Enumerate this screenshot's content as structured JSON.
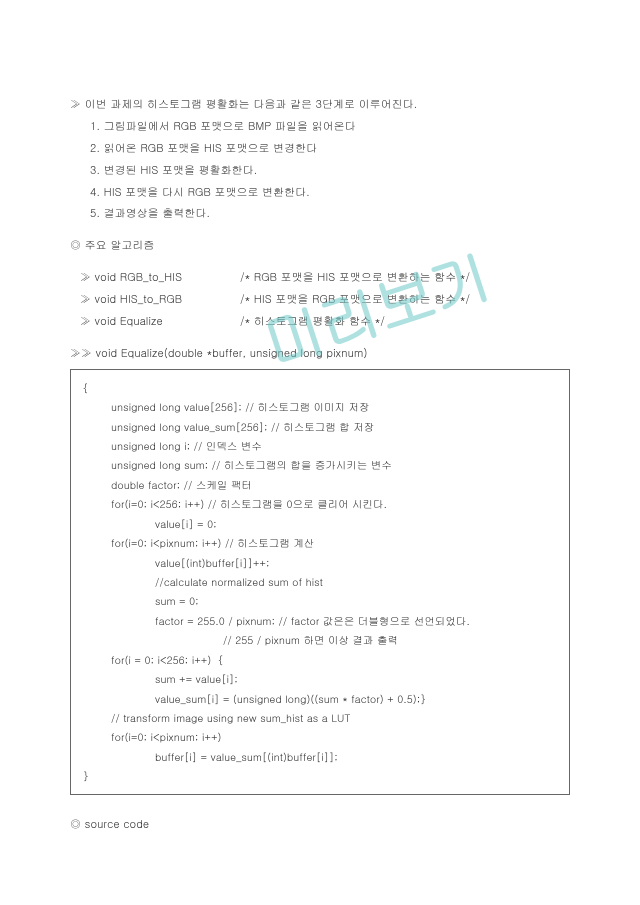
{
  "watermark": "미리보기",
  "intro": {
    "prefix": "≫ ",
    "text": "이번 과제의 히스토그램 평활화는 다음과 같은 3단계로 이루어진다.",
    "steps": [
      "1. 그림파일에서 RGB 포맷으로 BMP 파일을 읽어온다",
      "2. 읽어온 RGB 포맷을 HIS 포맷으로 변경한다",
      "3. 변경된 HIS 포맷을 평활화한다.",
      "4. HIS 포맷을 다시 RGB 포맷으로 변환한다.",
      "5. 결과영상을 출력한다."
    ]
  },
  "section_algo": {
    "marker": "◎ ",
    "title": "주요 알고리즘",
    "rows": [
      {
        "left": "≫  void RGB_to_HIS",
        "right": "/* RGB 포맷을 HIS 포맷으로 변환하는 함수 */"
      },
      {
        "left": "≫  void HIS_to_RGB",
        "right": "/* HIS 포맷을 RGB 포맷으로 변환하는 함수 */"
      },
      {
        "left": "≫  void Equalize",
        "right": "/* 히스토그램 평활화 함수 */"
      }
    ]
  },
  "fn_sig": {
    "prefix": "≫≫  ",
    "text": "void Equalize(double *buffer, unsigned long pixnum)"
  },
  "code": {
    "open": "{",
    "lines": [
      {
        "cls": "ci-1",
        "text": "unsigned long value[256]; // 히스토그램 이미지 저장"
      },
      {
        "cls": "ci-1",
        "text": "unsigned long value_sum[256]; // 히스토그램 합 저장"
      },
      {
        "cls": "ci-1",
        "text": "unsigned long i; // 인덱스 변수"
      },
      {
        "cls": "ci-1",
        "text": "unsigned long sum; // 히스토그램의 합을 증가시키는 변수"
      },
      {
        "cls": "ci-1",
        "text": "double factor; // 스케일 팩터"
      },
      {
        "cls": "ci-1",
        "text": ""
      },
      {
        "cls": "ci-1",
        "text": "for(i=0; i<256; i++) // 히스토그램을 0으로 클리어 시킨다."
      },
      {
        "cls": "ci-2",
        "text": "value[i] = 0;"
      },
      {
        "cls": "ci-1",
        "text": "for(i=0; i<pixnum; i++) // 히스토그램 계산"
      },
      {
        "cls": "ci-2",
        "text": "value[(int)buffer[i]]++;"
      },
      {
        "cls": "ci-2",
        "text": "//calculate normalized sum of hist"
      },
      {
        "cls": "ci-2",
        "text": "sum = 0;"
      },
      {
        "cls": "ci-2",
        "text": "factor = 255.0 / pixnum; // factor 값은은 더블형으로 선언되었다."
      },
      {
        "cls": "ci-3",
        "text": "// 255 / pixnum 하면 이상 결과 출력"
      },
      {
        "cls": "ci-1",
        "text": "for(i = 0; i<256; i++)  {"
      },
      {
        "cls": "ci-2",
        "text": "sum += value[i];"
      },
      {
        "cls": "ci-2",
        "text": "value_sum[i] = (unsigned long)((sum * factor) + 0.5);}"
      },
      {
        "cls": "ci-1",
        "text": "// transform image using new sum_hist as a LUT"
      },
      {
        "cls": "ci-1",
        "text": "for(i=0; i<pixnum; i++)"
      },
      {
        "cls": "ci-2",
        "text": "buffer[i] = value_sum[(int)buffer[i]];"
      }
    ],
    "close": "}"
  },
  "section_source": {
    "marker": "◎ ",
    "title": "source code"
  }
}
